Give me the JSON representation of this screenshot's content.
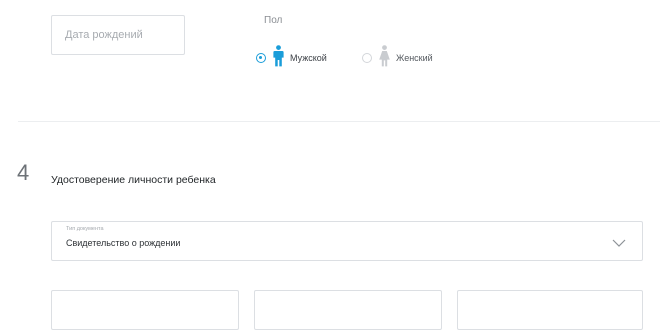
{
  "birth_date": {
    "placeholder": "Дата рождений"
  },
  "gender": {
    "label": "Пол",
    "options": [
      {
        "label": "Мужской",
        "selected": true
      },
      {
        "label": "Женский",
        "selected": false
      }
    ]
  },
  "section": {
    "number": "4",
    "title": "Удостоверение личности ребенка"
  },
  "document_type": {
    "label": "Тип документа",
    "value": "Свидетельство о рождении",
    "icon": "chevron-down-icon"
  },
  "colors": {
    "accent": "#1a9dd9",
    "field_border": "#dcdfe3",
    "male_figure": "#1a9dd9",
    "female_figure": "#c9ccd0"
  }
}
